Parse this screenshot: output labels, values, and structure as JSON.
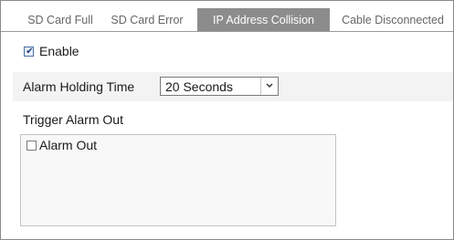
{
  "tabs": [
    {
      "label": "SD Card Full",
      "active": false
    },
    {
      "label": "SD Card Error",
      "active": false
    },
    {
      "label": "IP Address Collision",
      "active": true
    },
    {
      "label": "Cable Disconnected",
      "active": false
    }
  ],
  "enable": {
    "label": "Enable",
    "checked": true
  },
  "alarm_holding_time": {
    "label": "Alarm Holding Time",
    "value": "20 Seconds"
  },
  "trigger_alarm_out": {
    "label": "Trigger Alarm Out",
    "alarm_out": {
      "label": "Alarm Out",
      "checked": false
    }
  },
  "colors": {
    "active_tab_bg": "#8c8c8c",
    "row_bg": "#f3f3f3"
  }
}
